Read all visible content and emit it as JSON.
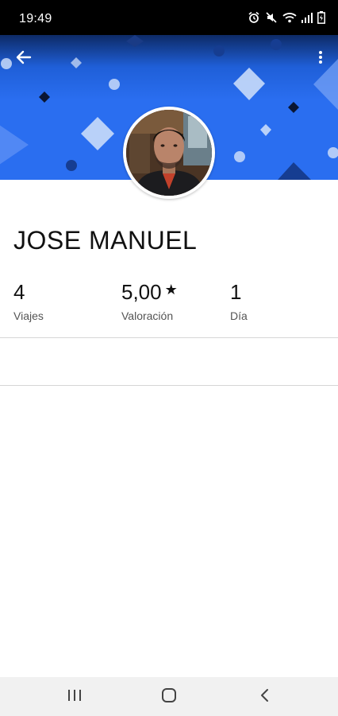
{
  "status_bar": {
    "time": "19:49",
    "icons": [
      "alarm-icon",
      "mute-icon",
      "wifi-icon",
      "signal-icon",
      "battery-charging-icon"
    ]
  },
  "header": {
    "back_icon": "arrow-left-icon",
    "menu_icon": "more-vertical-icon",
    "banner_color": "#2a6ef0"
  },
  "profile": {
    "name": "JOSE MANUEL"
  },
  "stats": [
    {
      "value": "4",
      "label": "Viajes"
    },
    {
      "value": "5,00",
      "star": "★",
      "label": "Valoración"
    },
    {
      "value": "1",
      "label": "Día"
    }
  ],
  "nav_bar": {
    "icons": [
      "recent-apps-icon",
      "home-icon",
      "back-icon"
    ]
  }
}
